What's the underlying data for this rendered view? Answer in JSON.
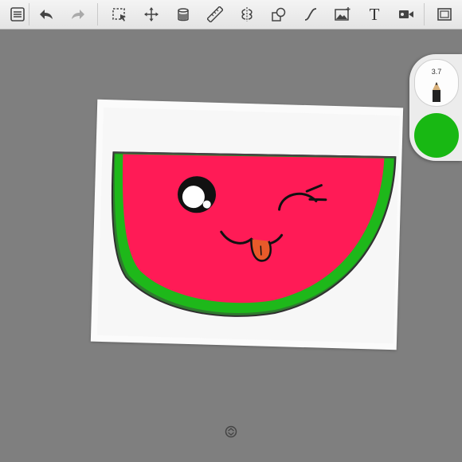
{
  "toolbar": {
    "items": [
      {
        "name": "gallery-list-icon"
      },
      {
        "name": "undo-icon"
      },
      {
        "name": "redo-icon"
      },
      {
        "name": "selection-icon"
      },
      {
        "name": "transform-move-icon"
      },
      {
        "name": "fill-bucket-icon"
      },
      {
        "name": "ruler-icon"
      },
      {
        "name": "symmetry-icon"
      },
      {
        "name": "shapes-icon"
      },
      {
        "name": "curve-pen-icon"
      },
      {
        "name": "import-image-icon"
      },
      {
        "name": "text-tool-icon",
        "label": "T"
      },
      {
        "name": "video-record-icon"
      },
      {
        "name": "fullscreen-icon"
      }
    ]
  },
  "brush_panel": {
    "size_value": "3.7",
    "current_color": "#18b813"
  },
  "colors": {
    "toolbar_bg": "#ececec",
    "canvas_bg": "#7f7f7f",
    "watermelon_flesh": "#ff1b56",
    "watermelon_rind": "#1eb81a",
    "tongue": "#e85a2a"
  }
}
